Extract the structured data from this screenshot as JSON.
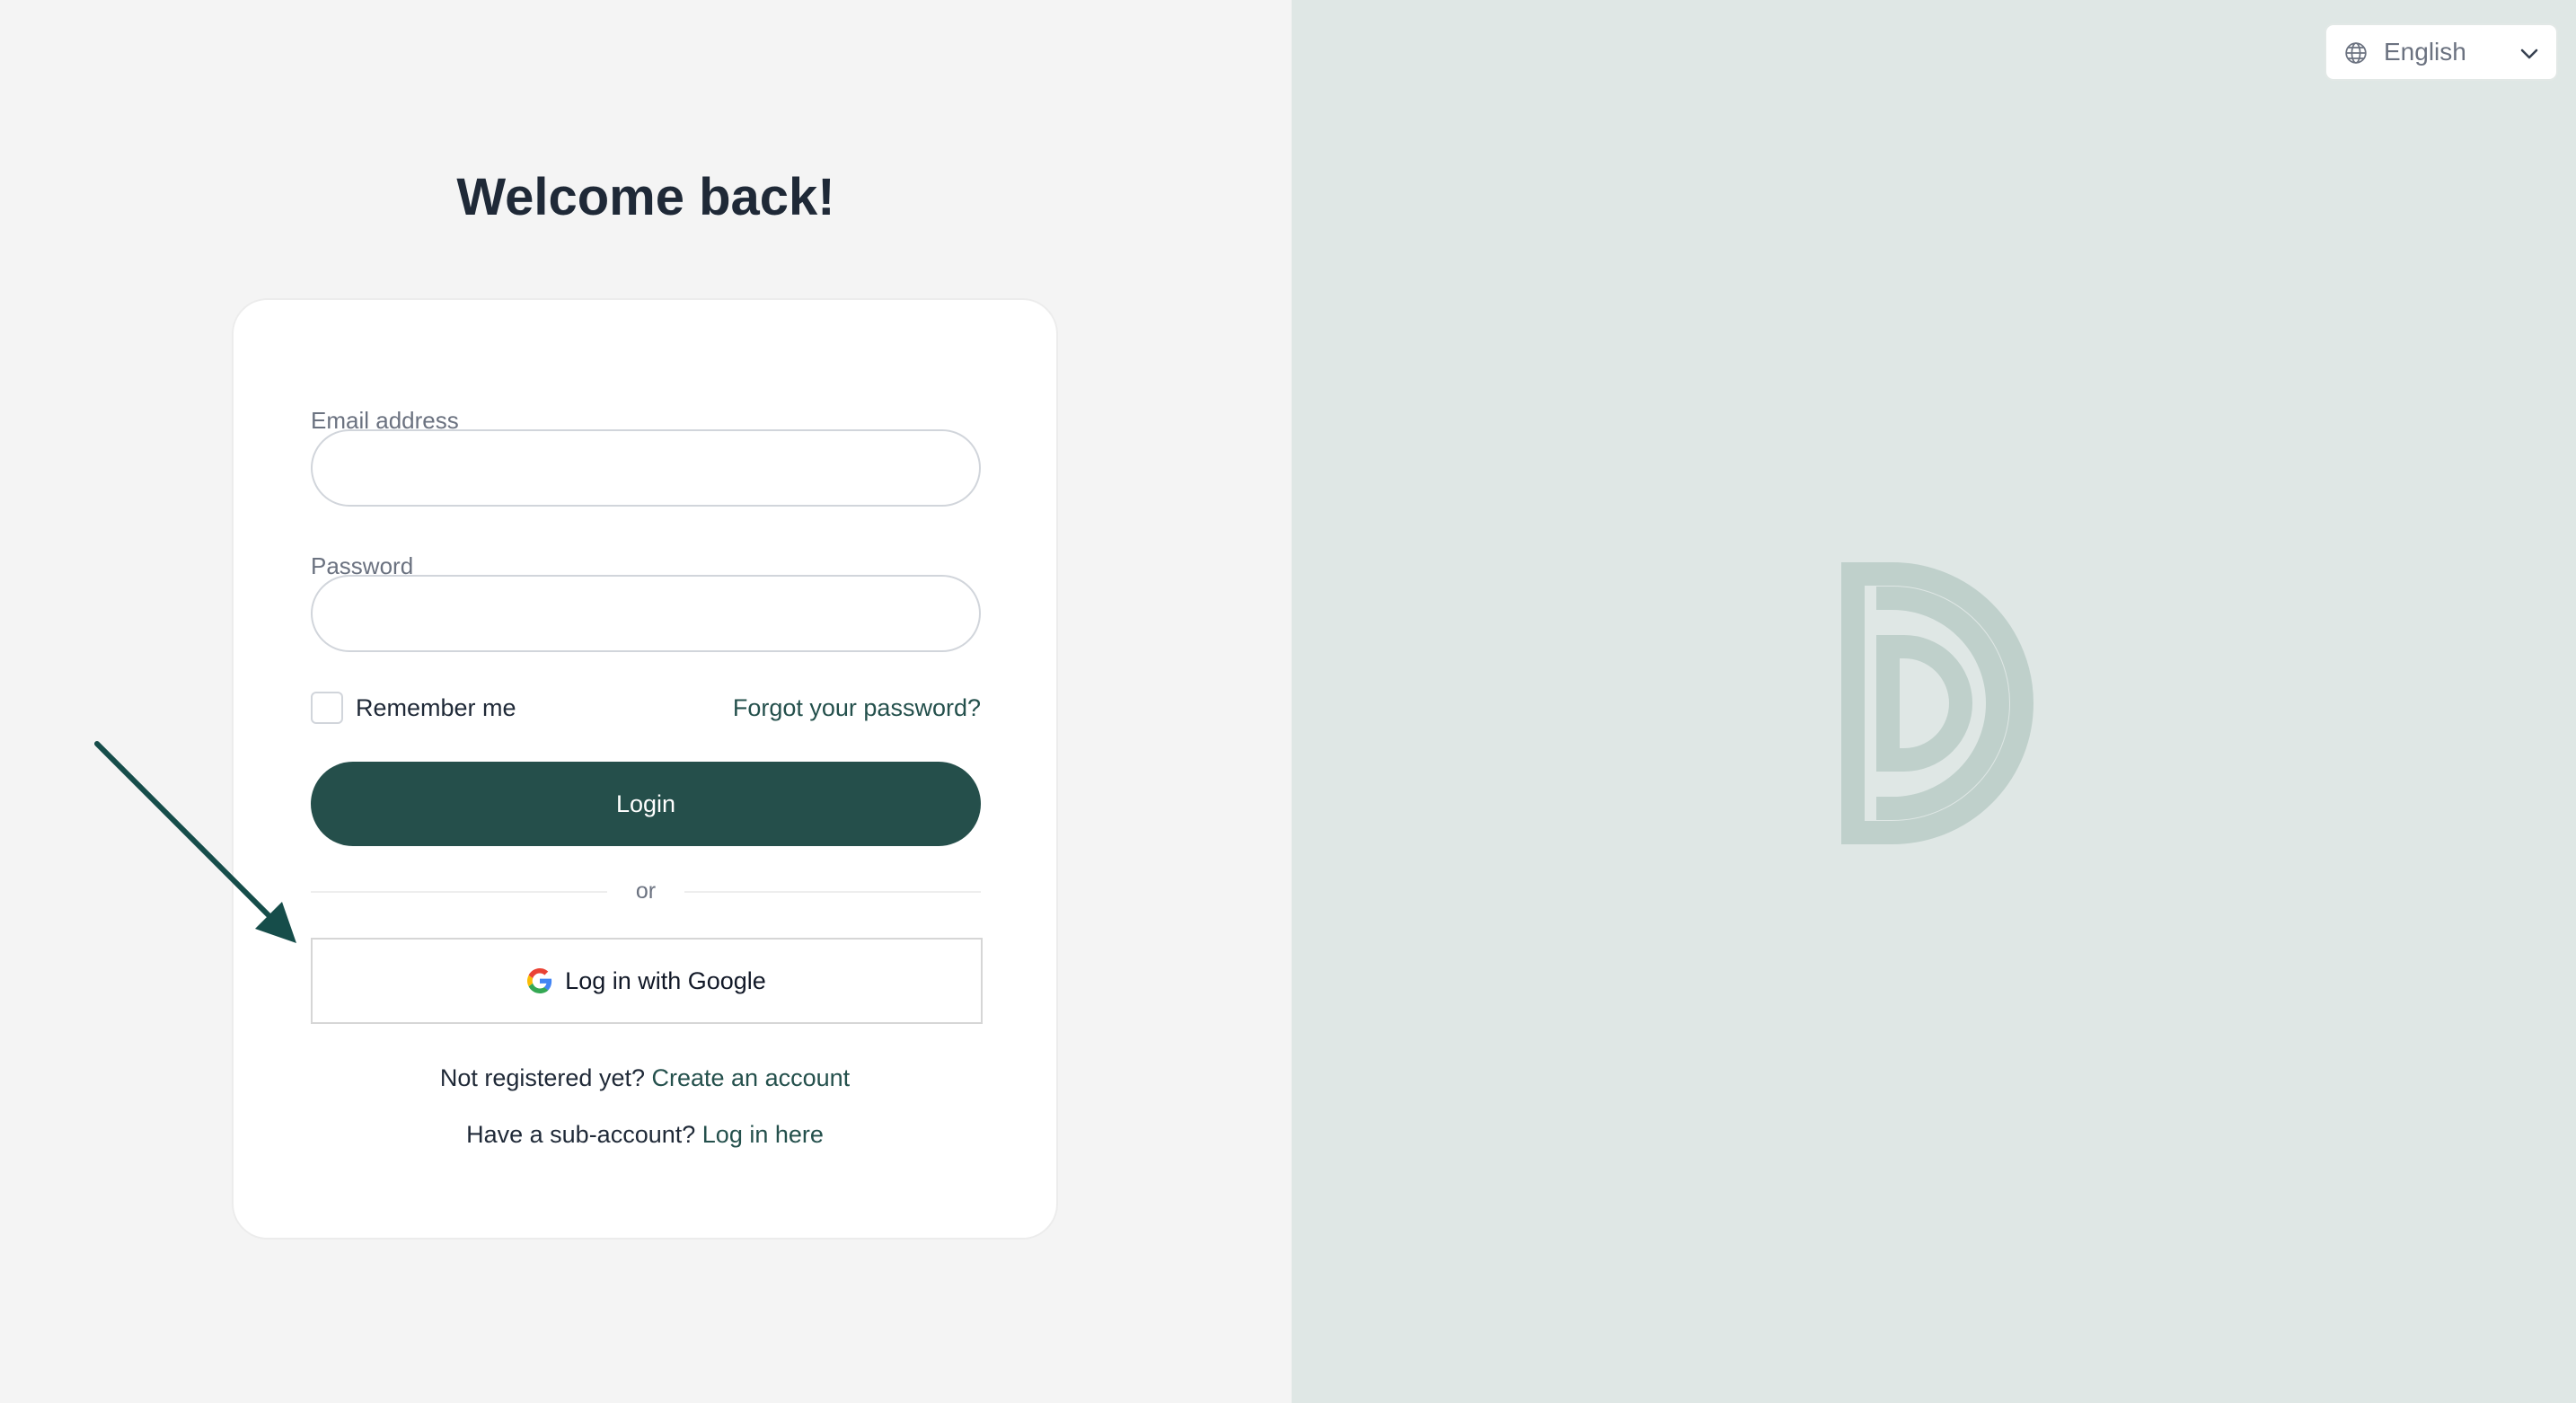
{
  "language_selector": {
    "label": "English",
    "icon": "globe-icon"
  },
  "login": {
    "title": "Welcome back!",
    "email_label": "Email address",
    "email_value": "",
    "password_label": "Password",
    "password_value": "",
    "remember_label": "Remember me",
    "remember_checked": false,
    "forgot_label": "Forgot your password?",
    "submit_label": "Login",
    "divider_label": "or",
    "google_label": "Log in with Google",
    "register_prompt": "Not registered yet?",
    "register_link": "Create an account",
    "subaccount_prompt": "Have a sub-account?",
    "subaccount_link": "Log in here"
  },
  "colors": {
    "primary": "#254f4b",
    "link": "#24504c",
    "left_background": "#f4f4f4",
    "right_background": "#dfe7e5",
    "logo": "#bfd0cb"
  }
}
